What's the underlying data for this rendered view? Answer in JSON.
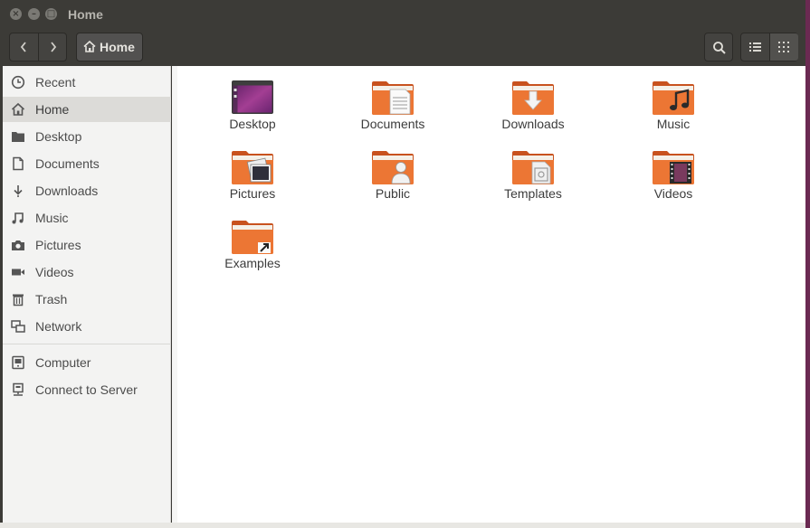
{
  "window": {
    "title": "Home"
  },
  "toolbar": {
    "breadcrumb": {
      "label": "Home",
      "icon": "home-icon"
    },
    "back_icon": "‹",
    "forward_icon": "›"
  },
  "sidebar": {
    "places": [
      {
        "label": "Recent",
        "icon": "clock-icon"
      },
      {
        "label": "Home",
        "icon": "home-icon",
        "active": true
      },
      {
        "label": "Desktop",
        "icon": "folder-icon"
      },
      {
        "label": "Documents",
        "icon": "document-icon"
      },
      {
        "label": "Downloads",
        "icon": "download-icon"
      },
      {
        "label": "Music",
        "icon": "music-icon"
      },
      {
        "label": "Pictures",
        "icon": "camera-icon"
      },
      {
        "label": "Videos",
        "icon": "video-icon"
      },
      {
        "label": "Trash",
        "icon": "trash-icon"
      },
      {
        "label": "Network",
        "icon": "network-icon"
      }
    ],
    "devices": [
      {
        "label": "Computer",
        "icon": "computer-icon"
      },
      {
        "label": "Connect to Server",
        "icon": "server-icon"
      }
    ]
  },
  "files": [
    {
      "label": "Desktop",
      "icon": "desktop-folder-icon"
    },
    {
      "label": "Documents",
      "icon": "documents-folder-icon"
    },
    {
      "label": "Downloads",
      "icon": "downloads-folder-icon"
    },
    {
      "label": "Music",
      "icon": "music-folder-icon"
    },
    {
      "label": "Pictures",
      "icon": "pictures-folder-icon"
    },
    {
      "label": "Public",
      "icon": "public-folder-icon"
    },
    {
      "label": "Templates",
      "icon": "templates-folder-icon"
    },
    {
      "label": "Videos",
      "icon": "videos-folder-icon"
    },
    {
      "label": "Examples",
      "icon": "examples-folder-icon"
    }
  ],
  "colors": {
    "titlebar": "#3c3b37",
    "folder_orange": "#e86a2e",
    "desktop_purple": "#8b2a8a",
    "sidebar_active": "#dcdbd8"
  }
}
